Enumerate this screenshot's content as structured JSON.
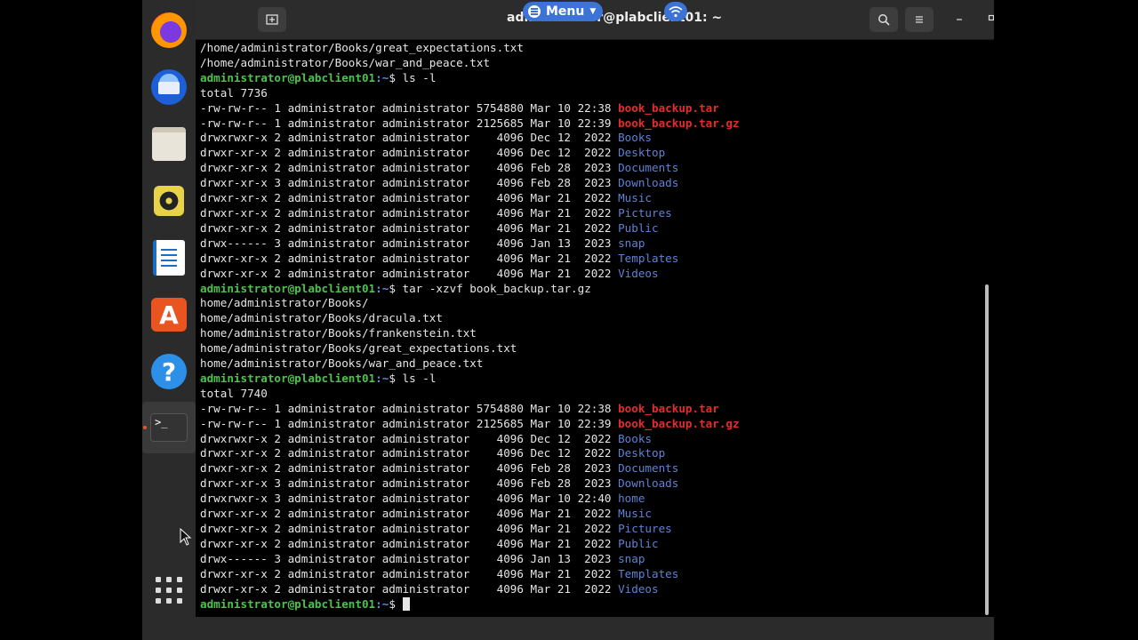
{
  "window": {
    "title": "administrator@plabclient01: ~",
    "menu_label": "Menu"
  },
  "dock": {
    "items": [
      "firefox-icon",
      "thunderbird-icon",
      "files-icon",
      "rhythmbox-icon",
      "writer-icon",
      "software-icon",
      "help-icon",
      "terminal-icon",
      "show-apps-icon"
    ],
    "terminal_glyph": ">_"
  },
  "terminal": {
    "prompt_user": "administrator@plabclient01",
    "prompt_path": ":~",
    "prompt_symbol": "$",
    "lines": [
      {
        "type": "out",
        "text": "/home/administrator/Books/great_expectations.txt"
      },
      {
        "type": "out",
        "text": "/home/administrator/Books/war_and_peace.txt"
      },
      {
        "type": "cmd",
        "text": " ls -l"
      },
      {
        "type": "out",
        "text": "total 7736"
      },
      {
        "type": "ls",
        "meta": "-rw-rw-r-- 1 administrator administrator 5754880 Mar 10 22:38 ",
        "name": "book_backup.tar",
        "kind": "arc"
      },
      {
        "type": "ls",
        "meta": "-rw-rw-r-- 1 administrator administrator 2125685 Mar 10 22:39 ",
        "name": "book_backup.tar.gz",
        "kind": "arc"
      },
      {
        "type": "ls",
        "meta": "drwxrwxr-x 2 administrator administrator    4096 Dec 12  2022 ",
        "name": "Books",
        "kind": "dir"
      },
      {
        "type": "ls",
        "meta": "drwxr-xr-x 2 administrator administrator    4096 Dec 12  2022 ",
        "name": "Desktop",
        "kind": "dir"
      },
      {
        "type": "ls",
        "meta": "drwxr-xr-x 2 administrator administrator    4096 Feb 28  2023 ",
        "name": "Documents",
        "kind": "dir"
      },
      {
        "type": "ls",
        "meta": "drwxr-xr-x 3 administrator administrator    4096 Feb 28  2023 ",
        "name": "Downloads",
        "kind": "dir"
      },
      {
        "type": "ls",
        "meta": "drwxr-xr-x 2 administrator administrator    4096 Mar 21  2022 ",
        "name": "Music",
        "kind": "dir"
      },
      {
        "type": "ls",
        "meta": "drwxr-xr-x 2 administrator administrator    4096 Mar 21  2022 ",
        "name": "Pictures",
        "kind": "dir"
      },
      {
        "type": "ls",
        "meta": "drwxr-xr-x 2 administrator administrator    4096 Mar 21  2022 ",
        "name": "Public",
        "kind": "dir"
      },
      {
        "type": "ls",
        "meta": "drwx------ 3 administrator administrator    4096 Jan 13  2023 ",
        "name": "snap",
        "kind": "dir"
      },
      {
        "type": "ls",
        "meta": "drwxr-xr-x 2 administrator administrator    4096 Mar 21  2022 ",
        "name": "Templates",
        "kind": "dir"
      },
      {
        "type": "ls",
        "meta": "drwxr-xr-x 2 administrator administrator    4096 Mar 21  2022 ",
        "name": "Videos",
        "kind": "dir"
      },
      {
        "type": "cmd",
        "text": " tar -xzvf book_backup.tar.gz"
      },
      {
        "type": "out",
        "text": "home/administrator/Books/"
      },
      {
        "type": "out",
        "text": "home/administrator/Books/dracula.txt"
      },
      {
        "type": "out",
        "text": "home/administrator/Books/frankenstein.txt"
      },
      {
        "type": "out",
        "text": "home/administrator/Books/great_expectations.txt"
      },
      {
        "type": "out",
        "text": "home/administrator/Books/war_and_peace.txt"
      },
      {
        "type": "cmd",
        "text": " ls -l"
      },
      {
        "type": "out",
        "text": "total 7740"
      },
      {
        "type": "ls",
        "meta": "-rw-rw-r-- 1 administrator administrator 5754880 Mar 10 22:38 ",
        "name": "book_backup.tar",
        "kind": "arc"
      },
      {
        "type": "ls",
        "meta": "-rw-rw-r-- 1 administrator administrator 2125685 Mar 10 22:39 ",
        "name": "book_backup.tar.gz",
        "kind": "arc"
      },
      {
        "type": "ls",
        "meta": "drwxrwxr-x 2 administrator administrator    4096 Dec 12  2022 ",
        "name": "Books",
        "kind": "dir"
      },
      {
        "type": "ls",
        "meta": "drwxr-xr-x 2 administrator administrator    4096 Dec 12  2022 ",
        "name": "Desktop",
        "kind": "dir"
      },
      {
        "type": "ls",
        "meta": "drwxr-xr-x 2 administrator administrator    4096 Feb 28  2023 ",
        "name": "Documents",
        "kind": "dir"
      },
      {
        "type": "ls",
        "meta": "drwxr-xr-x 3 administrator administrator    4096 Feb 28  2023 ",
        "name": "Downloads",
        "kind": "dir"
      },
      {
        "type": "ls",
        "meta": "drwxrwxr-x 3 administrator administrator    4096 Mar 10 22:40 ",
        "name": "home",
        "kind": "dir"
      },
      {
        "type": "ls",
        "meta": "drwxr-xr-x 2 administrator administrator    4096 Mar 21  2022 ",
        "name": "Music",
        "kind": "dir"
      },
      {
        "type": "ls",
        "meta": "drwxr-xr-x 2 administrator administrator    4096 Mar 21  2022 ",
        "name": "Pictures",
        "kind": "dir"
      },
      {
        "type": "ls",
        "meta": "drwxr-xr-x 2 administrator administrator    4096 Mar 21  2022 ",
        "name": "Public",
        "kind": "dir"
      },
      {
        "type": "ls",
        "meta": "drwx------ 3 administrator administrator    4096 Jan 13  2023 ",
        "name": "snap",
        "kind": "dir"
      },
      {
        "type": "ls",
        "meta": "drwxr-xr-x 2 administrator administrator    4096 Mar 21  2022 ",
        "name": "Templates",
        "kind": "dir"
      },
      {
        "type": "ls",
        "meta": "drwxr-xr-x 2 administrator administrator    4096 Mar 21  2022 ",
        "name": "Videos",
        "kind": "dir"
      },
      {
        "type": "prompt",
        "text": " "
      }
    ]
  },
  "colors": {
    "prompt_user": "#4ec14e",
    "prompt_path": "#6a8bd8",
    "directory": "#5f82d4",
    "archive": "#e52b2b",
    "accent": "#e95420"
  }
}
